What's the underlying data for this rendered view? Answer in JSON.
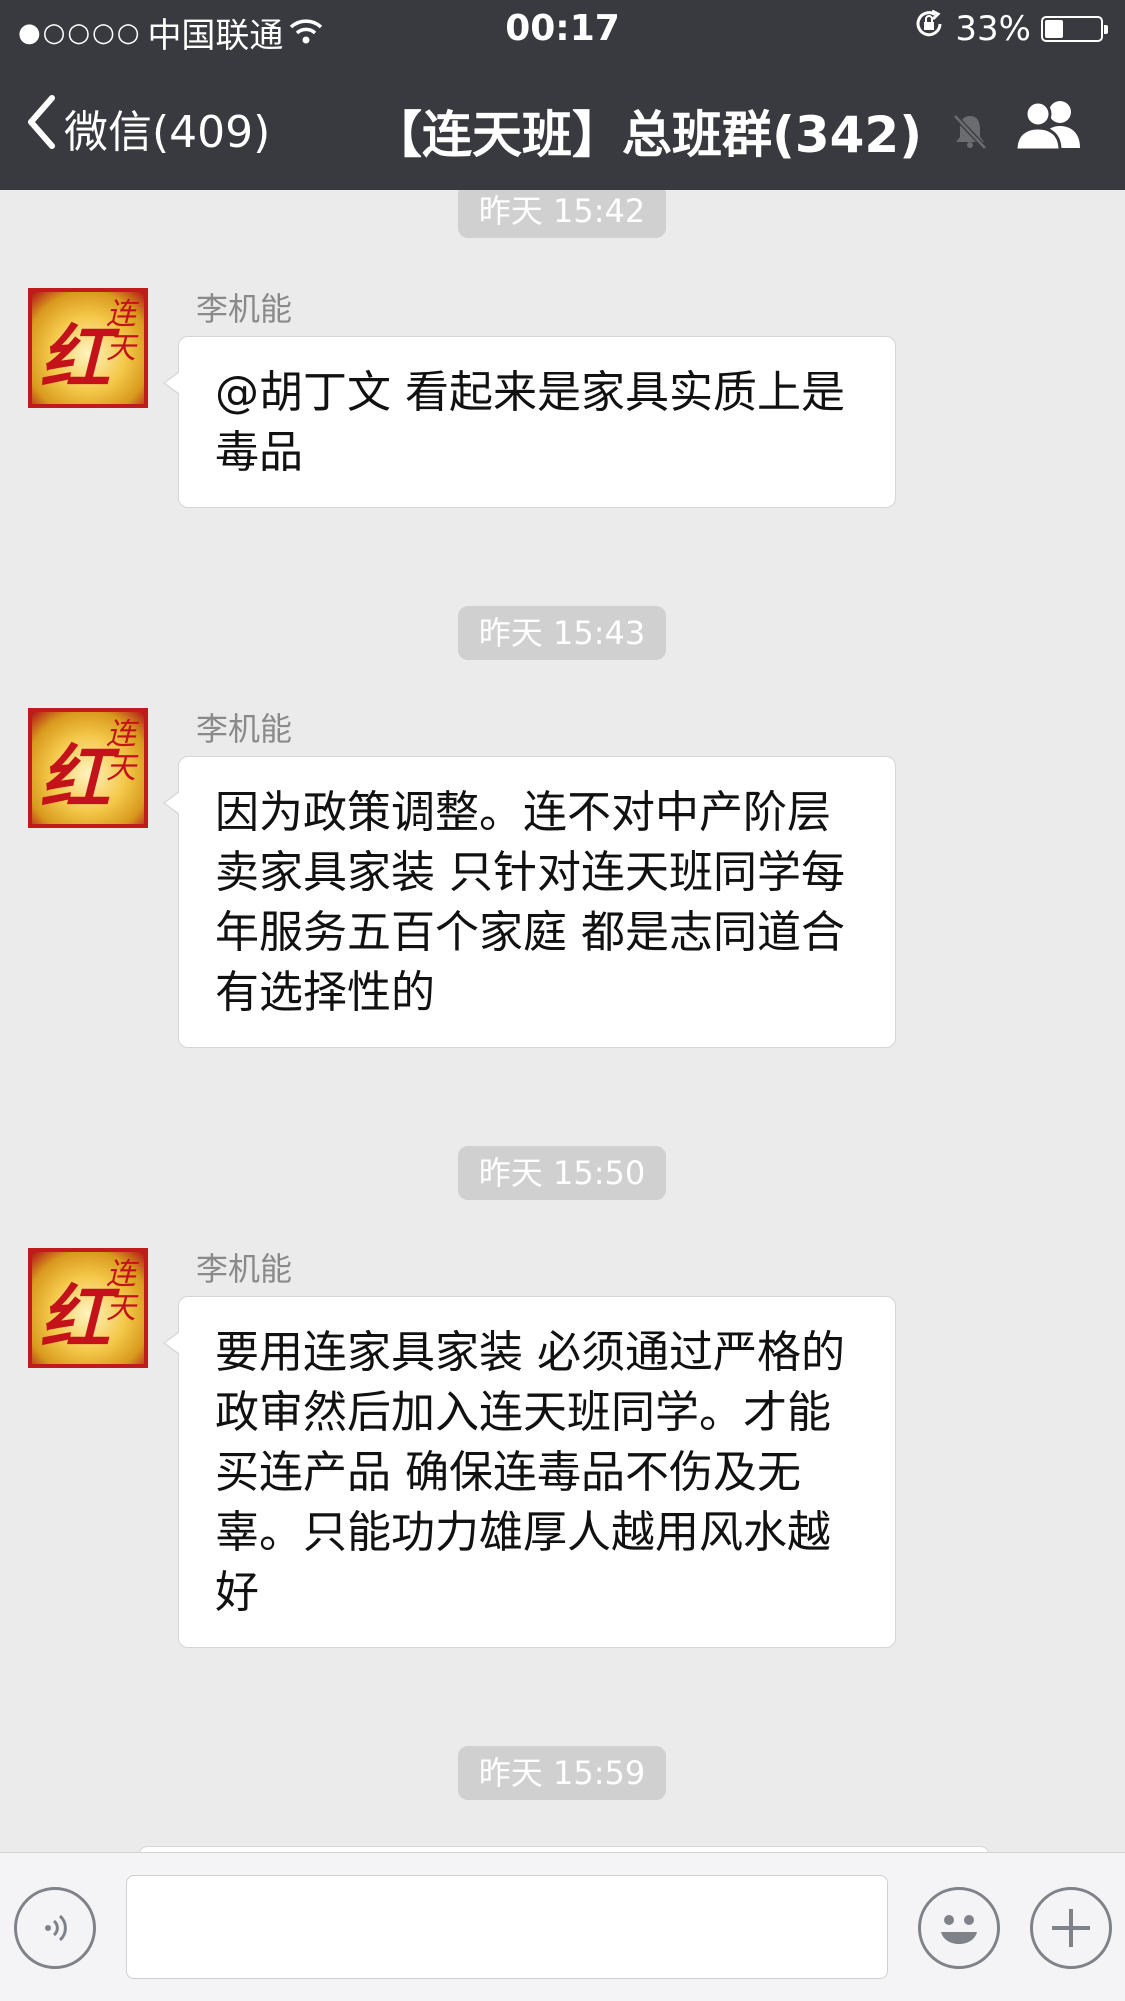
{
  "status_bar": {
    "signal_dots": "●○○○○",
    "carrier": "中国联通",
    "time": "00:17",
    "battery_text": "33%",
    "battery_level": 0.33
  },
  "nav": {
    "back_label": "微信(409)",
    "title": "【连天班】总班群(342)"
  },
  "avatar": {
    "glyph_main": "红",
    "glyph_side": "连天",
    "colors": {
      "red": "#c4121b",
      "gold": "#f4c84a"
    }
  },
  "messages": [
    {
      "timestamp": "昨天 15:42",
      "sender": "李机能",
      "text": "@胡丁文 看起来是家具实质上是毒品"
    },
    {
      "timestamp": "昨天 15:43",
      "sender": "李机能",
      "text": "因为政策调整。连不对中产阶层卖家具家装 只针对连天班同学每年服务五百个家庭 都是志同道合有选择性的"
    },
    {
      "timestamp": "昨天 15:50",
      "sender": "李机能",
      "text": "要用连家具家装 必须通过严格的政审然后加入连天班同学。才能买连产品  确保连毒品不伤及无辜。只能功力雄厚人越用风水越好"
    }
  ],
  "last_timestamp": "昨天 15:59",
  "input": {
    "value": "",
    "icons": [
      "voice-icon",
      "emoji-icon",
      "plus-icon"
    ]
  },
  "colors": {
    "nav_bg": "#393a3f",
    "chat_bg": "#ebebeb",
    "timestamp_bg": "#d0d0d0",
    "bubble_bg": "#ffffff"
  }
}
